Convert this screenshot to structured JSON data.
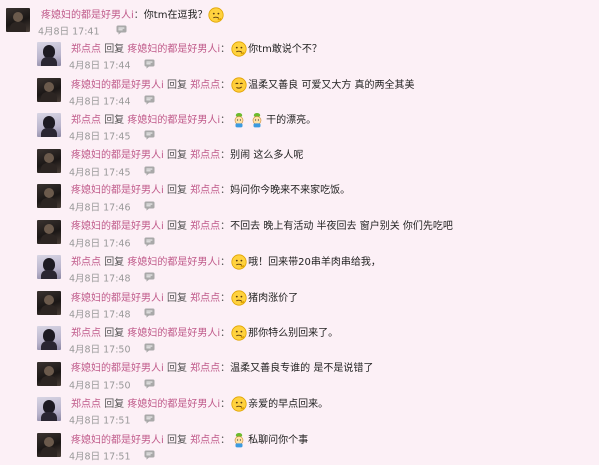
{
  "labels": {
    "reply_word": "回复",
    "colon": "："
  },
  "post": {
    "author": "疼媳妇的都是好男人i",
    "text": "你tm在逗我？",
    "emoji": "thinking-face-emoji",
    "date": "4月8日",
    "time": "17:41"
  },
  "replies": [
    {
      "author": "郑点点",
      "target": "疼媳妇的都是好男人i",
      "pre_emoji": "thinking-face-emoji",
      "text": "你tm敢说个不？",
      "date": "4月8日",
      "time": "17:44",
      "avatar": "woman"
    },
    {
      "author": "疼媳妇的都是好男人i",
      "target": "郑点点",
      "pre_emoji": "smirk-face-emoji",
      "text": "温柔又善良 可爱又大方 真的两全其美",
      "date": "4月8日",
      "time": "17:44",
      "avatar": "man"
    },
    {
      "author": "郑点点",
      "target": "疼媳妇的都是好男人i",
      "pre_emoji": "sprout-cartoon-emoji-x2",
      "text": "干的漂亮。",
      "date": "4月8日",
      "time": "17:45",
      "avatar": "woman"
    },
    {
      "author": "疼媳妇的都是好男人i",
      "target": "郑点点",
      "pre_emoji": "",
      "text": "别闹 这么多人呢",
      "date": "4月8日",
      "time": "17:45",
      "avatar": "man"
    },
    {
      "author": "疼媳妇的都是好男人i",
      "target": "郑点点",
      "pre_emoji": "",
      "text": "妈问你今晚来不来家吃饭。",
      "date": "4月8日",
      "time": "17:46",
      "avatar": "man"
    },
    {
      "author": "疼媳妇的都是好男人i",
      "target": "郑点点",
      "pre_emoji": "",
      "text": "不回去 晚上有活动 半夜回去 窗户别关 你们先吃吧",
      "date": "4月8日",
      "time": "17:46",
      "avatar": "man"
    },
    {
      "author": "郑点点",
      "target": "疼媳妇的都是好男人i",
      "pre_emoji": "thinking-face-emoji",
      "text": "哦！回来带20串羊肉串给我，",
      "date": "4月8日",
      "time": "17:48",
      "avatar": "woman"
    },
    {
      "author": "疼媳妇的都是好男人i",
      "target": "郑点点",
      "pre_emoji": "thinking-face-emoji",
      "text": "猪肉涨价了",
      "date": "4月8日",
      "time": "17:48",
      "avatar": "man"
    },
    {
      "author": "郑点点",
      "target": "疼媳妇的都是好男人i",
      "pre_emoji": "thinking-face-emoji",
      "text": "那你特么别回来了。",
      "date": "4月8日",
      "time": "17:50",
      "avatar": "woman"
    },
    {
      "author": "疼媳妇的都是好男人i",
      "target": "郑点点",
      "pre_emoji": "",
      "text": "温柔又善良专谁的 是不是说错了",
      "date": "4月8日",
      "time": "17:50",
      "avatar": "man"
    },
    {
      "author": "郑点点",
      "target": "疼媳妇的都是好男人i",
      "pre_emoji": "thinking-face-emoji",
      "text": "亲爱的早点回来。",
      "date": "4月8日",
      "time": "17:51",
      "avatar": "woman"
    },
    {
      "author": "疼媳妇的都是好男人i",
      "target": "郑点点",
      "pre_emoji": "sprout-cartoon-emoji",
      "text": "私聊问你个事",
      "date": "4月8日",
      "time": "17:51",
      "avatar": "man"
    }
  ],
  "colors": {
    "username": "#c05a8a",
    "background": "#fcf0f6",
    "meta": "#999999"
  },
  "icons": {
    "comment": "comment-bubble-icon"
  }
}
